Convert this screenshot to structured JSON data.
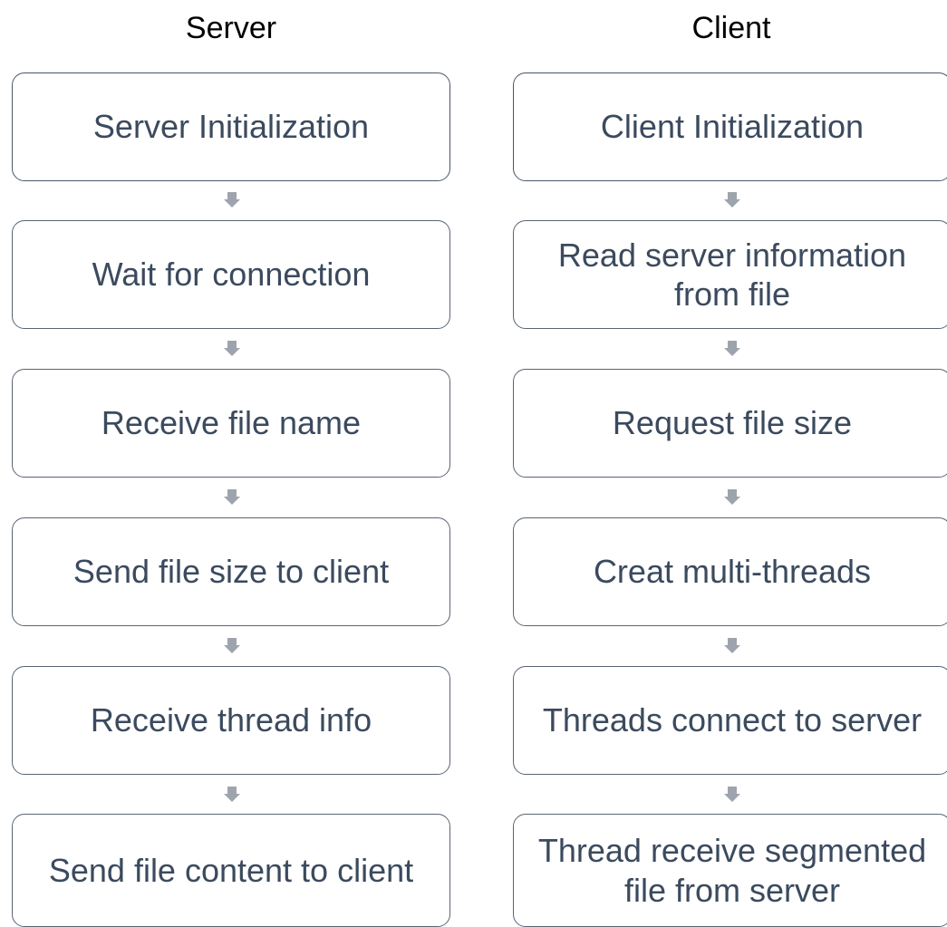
{
  "columns": {
    "server": {
      "title": "Server",
      "steps": [
        "Server Initialization",
        "Wait for connection",
        "Receive file name",
        "Send file size to client",
        "Receive thread info",
        "Send file content to client"
      ]
    },
    "client": {
      "title": "Client",
      "steps": [
        "Client Initialization",
        "Read server information from file",
        "Request file size",
        "Creat multi-threads",
        "Threads connect to server",
        "Thread receive segmented file from server"
      ]
    }
  },
  "colors": {
    "box_border": "#5a6573",
    "box_text": "#3b4a5e",
    "arrow": "#9ea4ad",
    "title_text": "#000000"
  },
  "icons": {
    "arrow": "arrow-down-icon"
  }
}
